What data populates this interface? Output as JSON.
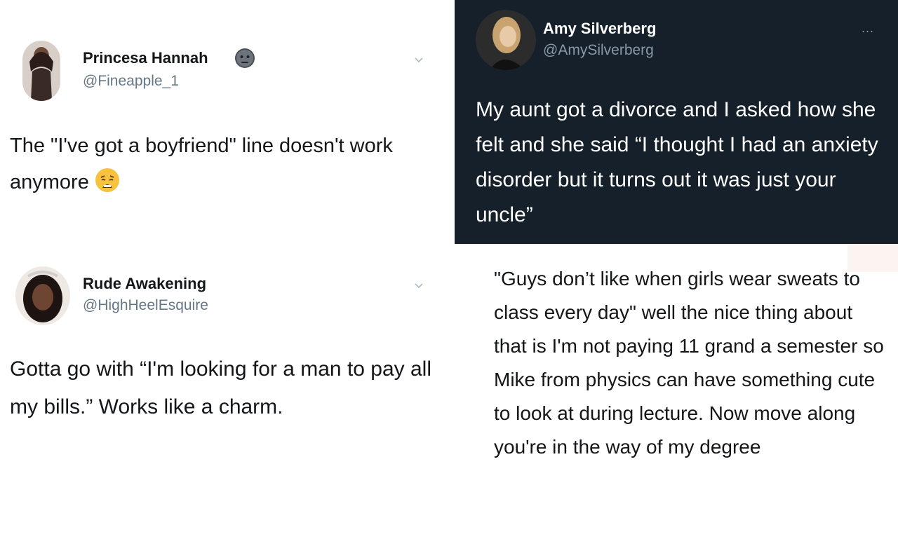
{
  "tweets": [
    {
      "name": "Princesa Hannah",
      "handle": "@Fineapple_1",
      "avatar_icon": "profile-avatar",
      "verified_icon": "neutral-face-emoji",
      "text": "The \"I've got a boyfriend\" line doesn't work anymore",
      "text_emoji": "weary-face-emoji"
    },
    {
      "name": "Amy Silverberg",
      "handle": "@AmySilverberg",
      "more_label": "...",
      "text": "My aunt got a divorce and I asked how she felt and she said “I thought I had an anxiety disorder but it turns out it was just your uncle”"
    },
    {
      "name": "Rude Awakening",
      "handle": "@HighHeelEsquire",
      "text": "Gotta go with “I'm looking for a man to pay all my bills.” Works like a charm."
    },
    {
      "text": "\"Guys don’t like when girls wear sweats to class every day\" well the nice thing about that is I'm not paying 11 grand a semester so Mike from physics can have something cute to look at during lecture. Now move along you're in the way of my degree"
    }
  ],
  "colors": {
    "dark_bg": "#15202b",
    "light_bg": "#ffffff",
    "secondary_text": "#657786"
  }
}
